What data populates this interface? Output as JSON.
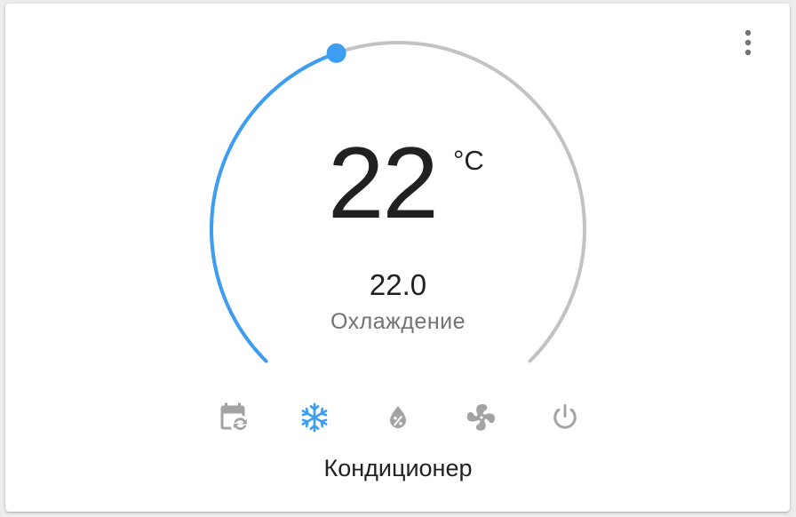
{
  "card": {
    "target_temperature": "22",
    "unit": "°C",
    "current_temperature": "22.0",
    "hvac_action": "Охлаждение",
    "name": "Кондиционер"
  },
  "dial": {
    "min_temp": 16,
    "max_temp": 30,
    "value": 22,
    "active_color": "#3c9df1",
    "track_color": "#c2c2c2"
  },
  "modes": [
    {
      "id": "auto",
      "icon": "calendar-sync-icon",
      "active": false
    },
    {
      "id": "cool",
      "icon": "snowflake-icon",
      "active": true
    },
    {
      "id": "dry",
      "icon": "water-percent-icon",
      "active": false
    },
    {
      "id": "fan_only",
      "icon": "fan-icon",
      "active": false
    },
    {
      "id": "off",
      "icon": "power-icon",
      "active": false
    }
  ],
  "colors": {
    "accent": "#3c9df1",
    "inactive_icon": "#a3a3a3",
    "text_primary": "#212121",
    "text_secondary": "#727272"
  }
}
